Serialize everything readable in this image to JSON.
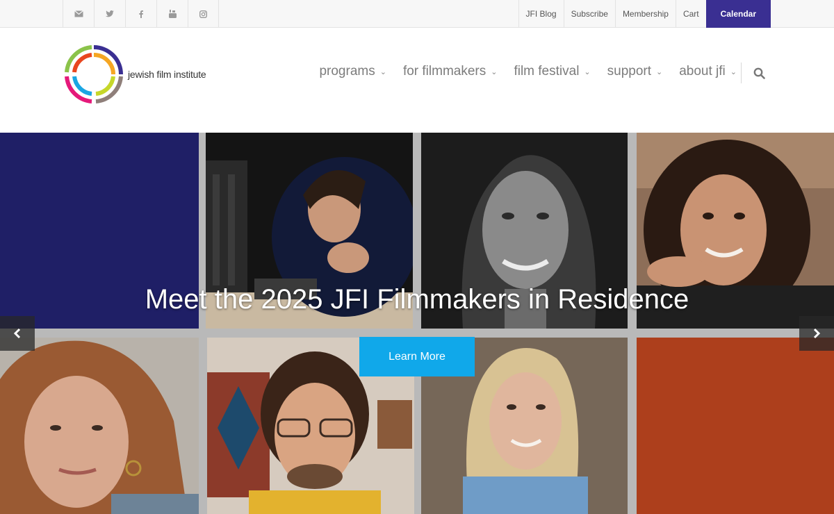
{
  "topbar": {
    "social_icons": [
      "envelope-icon",
      "twitter-icon",
      "facebook-icon",
      "youtube-icon",
      "instagram-icon"
    ],
    "links": {
      "blog": "JFI Blog",
      "subscribe": "Subscribe",
      "membership": "Membership",
      "cart": "Cart",
      "calendar": "Calendar"
    }
  },
  "logo": {
    "text": "jewish film institute"
  },
  "nav": {
    "items": [
      {
        "label": "programs"
      },
      {
        "label": "for filmmakers"
      },
      {
        "label": "film festival"
      },
      {
        "label": "support"
      },
      {
        "label": "about jfi"
      }
    ]
  },
  "hero": {
    "title": "Meet the 2025 JFI Filmmakers in Residence",
    "cta": "Learn More"
  },
  "colors": {
    "brand_purple": "#3a2f92",
    "cta_blue": "#10a8ea",
    "tile_navy": "#1f1f66",
    "tile_orange": "#ad3f1c"
  }
}
